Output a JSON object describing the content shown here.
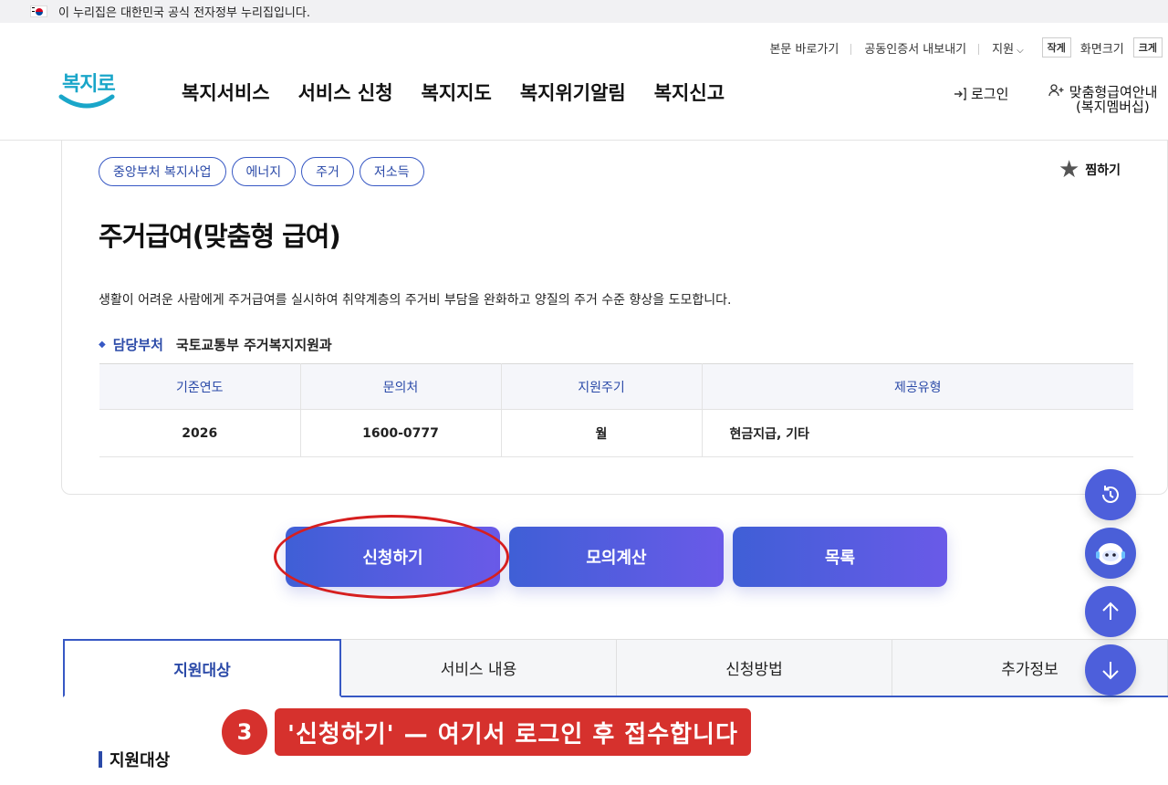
{
  "gov_banner": {
    "text": "이 누리집은 대한민국 공식 전자정부 누리집입니다."
  },
  "utility": {
    "skip": "본문 바로가기",
    "cert": "공동인증서 내보내기",
    "support": "지원",
    "small": "작게",
    "font_label": "화면크기",
    "large": "크게"
  },
  "logo": {
    "text": "복지로"
  },
  "gnb": [
    "복지서비스",
    "서비스 신청",
    "복지지도",
    "복지위기알림",
    "복지신고"
  ],
  "header": {
    "login": "로그인",
    "member_line1": "맞춤형급여안내",
    "member_line2": "(복지멤버십)"
  },
  "tags": [
    "중앙부처 복지사업",
    "에너지",
    "주거",
    "저소득"
  ],
  "favorite": "찜하기",
  "title": "주거급여(맞춤형 급여)",
  "description": "생활이 어려운 사람에게 주거급여를 실시하여 취약계층의 주거비 부담을 완화하고 양질의 주거 수준 향상을 도모합니다.",
  "department": {
    "label": "담당부처",
    "value": "국토교통부 주거복지지원과"
  },
  "info_table": {
    "headers": [
      "기준연도",
      "문의처",
      "지원주기",
      "제공유형"
    ],
    "row": [
      "2026",
      "1600-0777",
      "월",
      "현금지급, 기타"
    ]
  },
  "actions": {
    "apply": "신청하기",
    "simulate": "모의계산",
    "list": "목록"
  },
  "tabs": [
    "지원대상",
    "서비스 내용",
    "신청방법",
    "추가정보"
  ],
  "section_title": "지원대상",
  "callout": {
    "number": "3",
    "text": "'신청하기' — 여기서 로그인 후 접수합니다"
  },
  "colors": {
    "primary": "#3758c4",
    "button_start": "#3f5fd6",
    "button_end": "#6a5ae8",
    "callout": "#d6312d"
  }
}
